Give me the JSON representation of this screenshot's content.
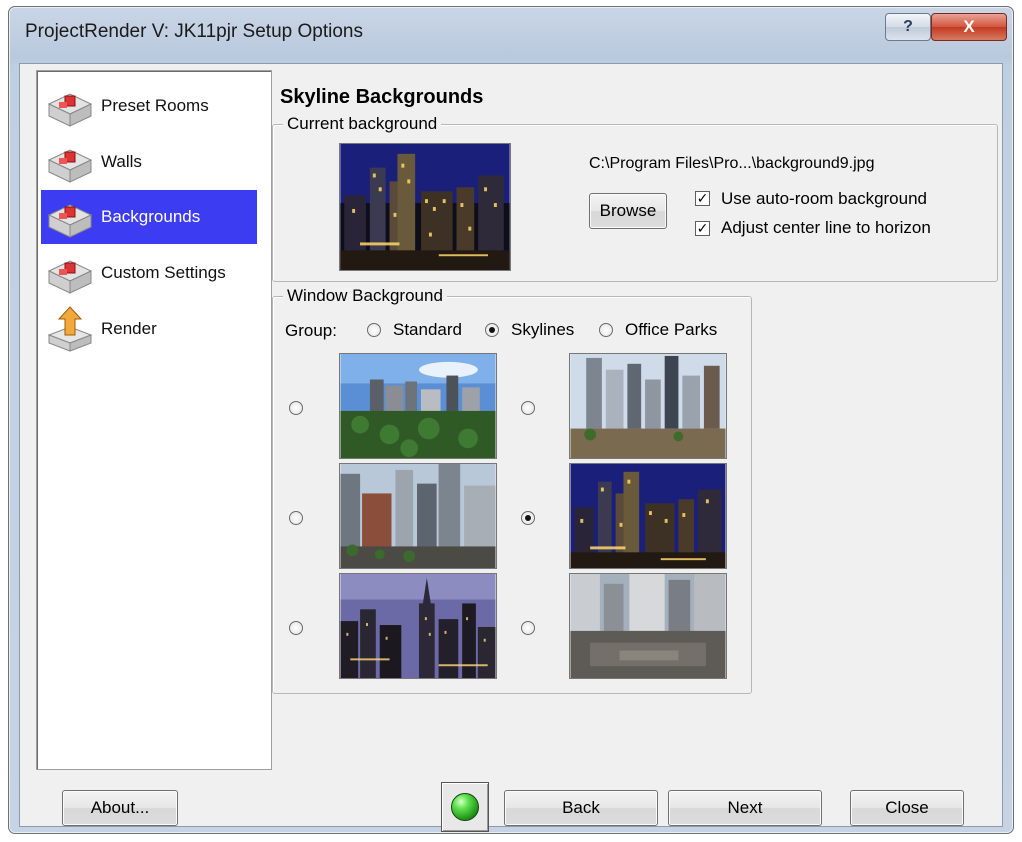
{
  "window": {
    "title": "ProjectRender V:  JK11pjr Setup Options",
    "help_label": "?",
    "close_label": "X"
  },
  "sidebar": {
    "items": [
      {
        "label": "Preset Rooms",
        "icon": "room-icon",
        "selected": false
      },
      {
        "label": "Walls",
        "icon": "room-icon",
        "selected": false
      },
      {
        "label": "Backgrounds",
        "icon": "room-icon",
        "selected": true
      },
      {
        "label": "Custom Settings",
        "icon": "room-icon",
        "selected": false
      },
      {
        "label": "Render",
        "icon": "render-arrow-icon",
        "selected": false
      }
    ]
  },
  "panel": {
    "title": "Skyline Backgrounds",
    "current_background": {
      "group_label": "Current background",
      "path": "C:\\Program Files\\Pro...\\background9.jpg",
      "browse_label": "Browse",
      "checkboxes": [
        {
          "label": "Use auto-room background",
          "checked": true
        },
        {
          "label": "Adjust center line to horizon",
          "checked": true
        }
      ]
    },
    "window_background": {
      "group_label": "Window Background",
      "group_prefix": "Group:",
      "groups": [
        {
          "label": "Standard",
          "checked": false
        },
        {
          "label": "Skylines",
          "checked": true
        },
        {
          "label": "Office Parks",
          "checked": false
        }
      ],
      "selected_thumbnail_index": 3
    }
  },
  "footer": {
    "about_label": "About...",
    "back_label": "Back",
    "next_label": "Next",
    "close_label": "Close",
    "status_color": "#2bb31e"
  }
}
